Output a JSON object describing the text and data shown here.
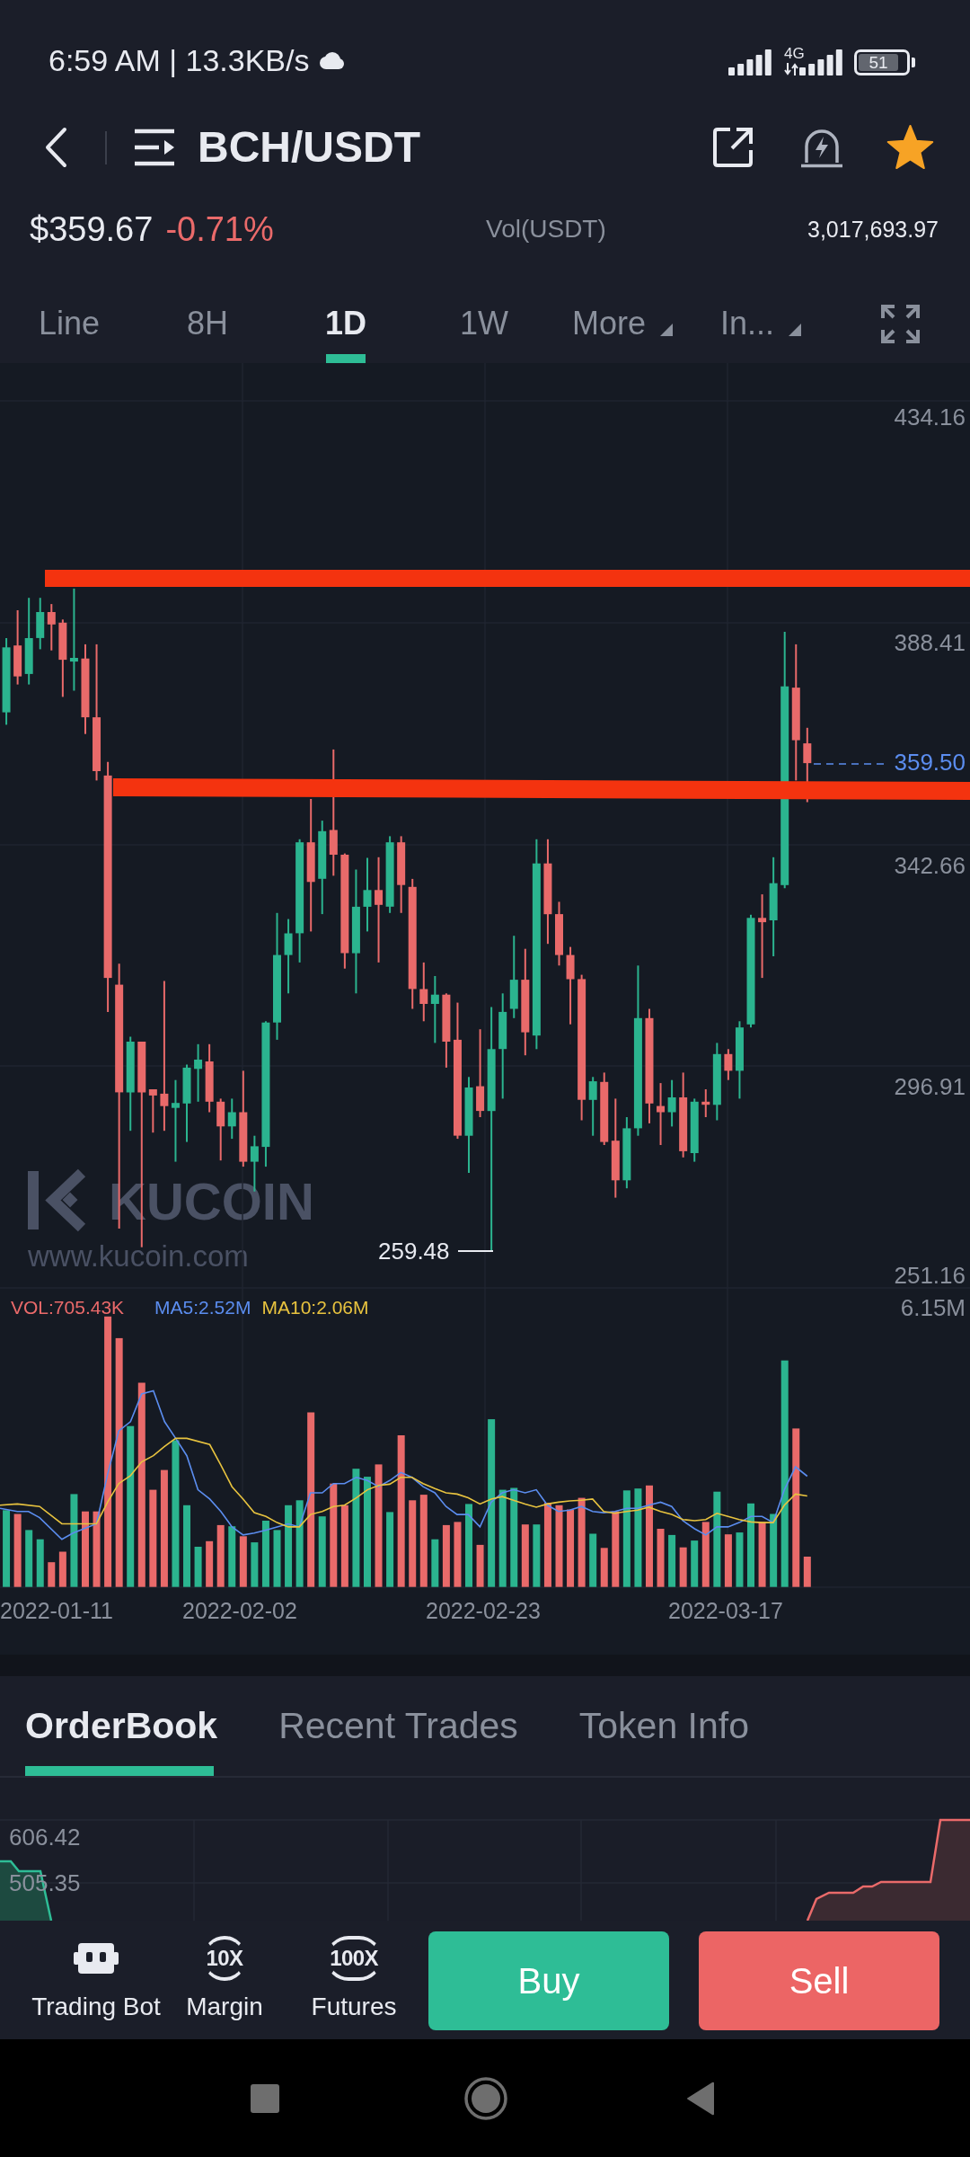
{
  "status_bar": {
    "time": "6:59 AM | 13.3KB/s",
    "network": "4G",
    "battery": "51"
  },
  "header": {
    "title": "BCH/USDT",
    "favorite": true
  },
  "ticker": {
    "price": "$359.67",
    "change": "-0.71%",
    "volume_label": "Vol(USDT)",
    "volume": "3,017,693.97"
  },
  "interval_tabs": [
    {
      "label": "Line",
      "kind": "option",
      "selected": false
    },
    {
      "label": "8H",
      "kind": "option",
      "selected": false
    },
    {
      "label": "1D",
      "kind": "option",
      "selected": true
    },
    {
      "label": "1W",
      "kind": "option",
      "selected": false
    },
    {
      "label": "More",
      "kind": "menu",
      "selected": false
    },
    {
      "label": "In...",
      "kind": "menu",
      "selected": false
    }
  ],
  "chart": {
    "price_ticks": [
      "434.16",
      "388.41",
      "342.66",
      "296.91",
      "251.16"
    ],
    "last_price": "359.50",
    "low_marker": "259.48",
    "watermark": {
      "brand": "KUCOIN",
      "url": "www.kucoin.com"
    },
    "volume_legend": [
      {
        "label": "VOL:705.43K",
        "color": "#ea6a6a"
      },
      {
        "label": "MA5:2.52M",
        "color": "#5b8def"
      },
      {
        "label": "MA10:2.06M",
        "color": "#e8c33f"
      }
    ],
    "volume_max": "6.15M",
    "dates": [
      "2022-01-11",
      "2022-02-02",
      "2022-02-23",
      "2022-03-17"
    ]
  },
  "detail_tabs": [
    {
      "label": "OrderBook",
      "selected": true
    },
    {
      "label": "Recent Trades",
      "selected": false
    },
    {
      "label": "Token Info",
      "selected": false
    }
  ],
  "depth_chart": {
    "price_labels": [
      "606.42",
      "505.35"
    ]
  },
  "shortcuts": [
    {
      "label": "Trading Bot",
      "kind": "bot"
    },
    {
      "label": "Margin",
      "kind": "leverage",
      "badge": "10X"
    },
    {
      "label": "Futures",
      "kind": "leverage",
      "badge": "100X"
    }
  ],
  "actions": [
    {
      "label": "Buy",
      "kind": "buy"
    },
    {
      "label": "Sell",
      "kind": "sell"
    }
  ]
}
